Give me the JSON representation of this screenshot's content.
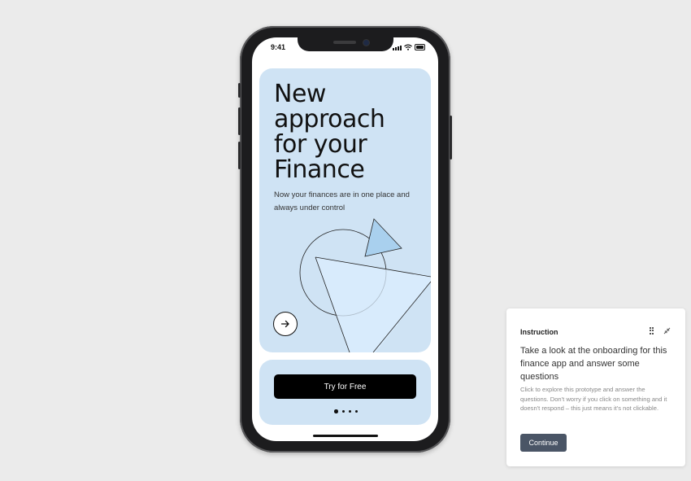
{
  "phone": {
    "status_time": "9:41",
    "hero": {
      "headline": "New approach for your Finance",
      "subtitle": "Now your finances are in one place and always under control",
      "next_icon": "arrow-right-icon"
    },
    "cta_label": "Try for Free",
    "page_indicator": {
      "count": 4,
      "active": 1
    }
  },
  "instruction_panel": {
    "title": "Instruction",
    "icons": [
      "drag-handle-icon",
      "collapse-icon"
    ],
    "heading": "Take a look at the onboarding for this finance app and answer some questions",
    "body": "Click to explore this prototype and answer the questions. Don't worry if you click on something and it doesn't respond – this just means it's not clickable.",
    "button_label": "Continue"
  },
  "colors": {
    "background": "#ebebeb",
    "card": "#cfe3f4",
    "cta": "#000000",
    "continue_button": "#4a5566"
  }
}
